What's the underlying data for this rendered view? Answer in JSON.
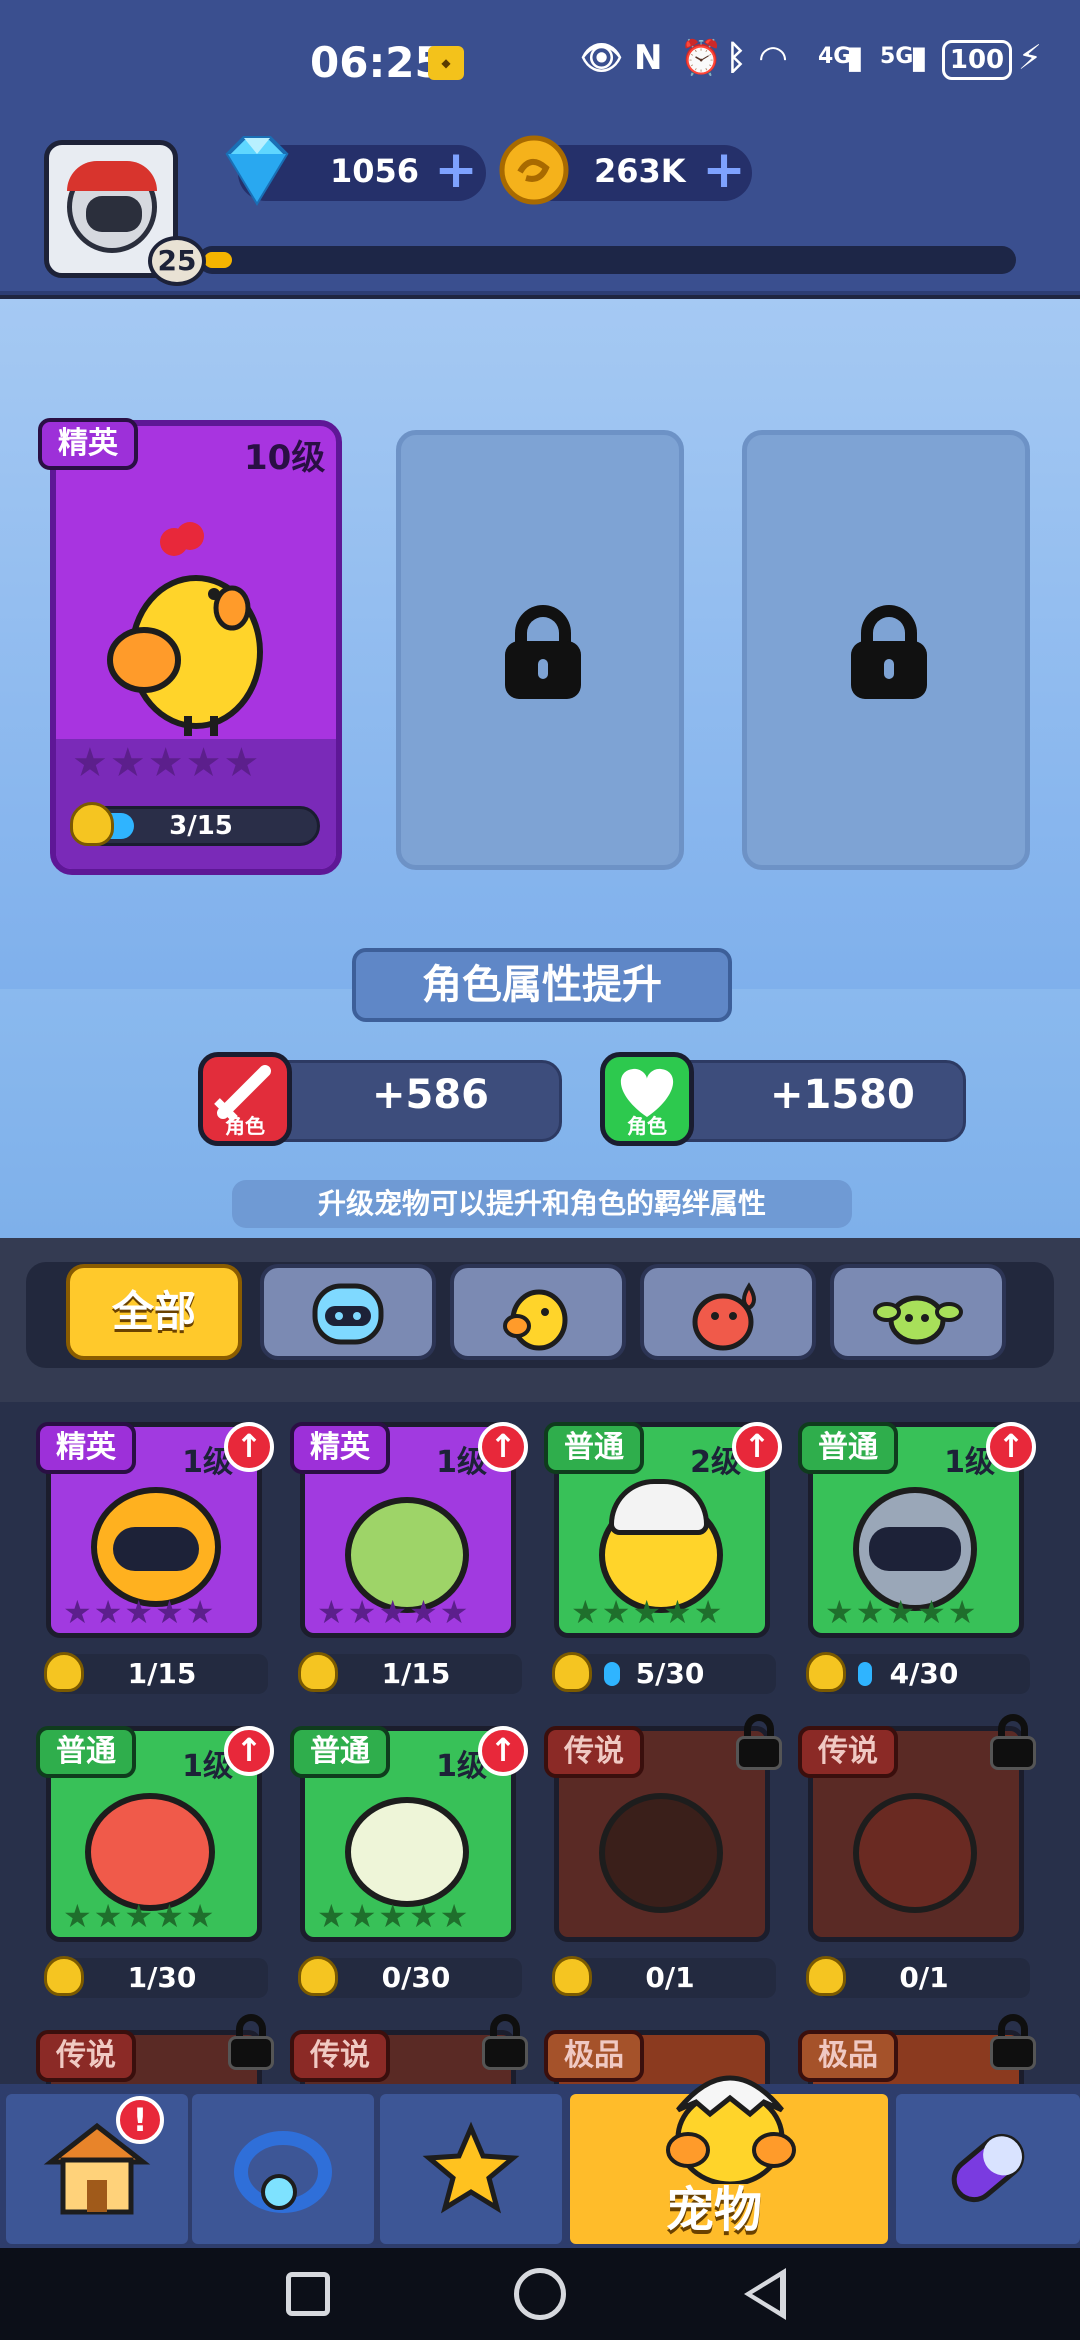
{
  "status_bar": {
    "time": "06:25",
    "battery": "100",
    "network1": "4G",
    "network2": "5G"
  },
  "player": {
    "level": "25",
    "gems": "1056",
    "coins": "263K",
    "xp_progress": 0.02
  },
  "equipped_slots": [
    {
      "rarity": "精英",
      "level": "10级",
      "progress": "3/15",
      "progress_value": 0.2,
      "stars": "★★★★★"
    },
    {
      "locked": true
    },
    {
      "locked": true
    }
  ],
  "bond": {
    "title": "角色属性提升",
    "attack_label": "角色",
    "attack_value": "+586",
    "hp_label": "角色",
    "hp_value": "+1580",
    "hint": "升级宠物可以提升和角色的羁绊属性"
  },
  "filter_tabs": {
    "all_label": "全部",
    "icons": [
      "robot-icon",
      "chick-icon",
      "fire-icon",
      "plant-icon"
    ]
  },
  "pets": [
    {
      "rarity": "精英",
      "level": "1级",
      "progress": "1/15",
      "stars": "★★★★★"
    },
    {
      "rarity": "精英",
      "level": "1级",
      "progress": "1/15",
      "stars": "★★★★★"
    },
    {
      "rarity": "普通",
      "level": "2级",
      "progress": "5/30",
      "stars": "★★★★★"
    },
    {
      "rarity": "普通",
      "level": "1级",
      "progress": "4/30",
      "stars": "★★★★★"
    },
    {
      "rarity": "普通",
      "level": "1级",
      "progress": "1/30",
      "stars": "★★★★★"
    },
    {
      "rarity": "普通",
      "level": "1级",
      "progress": "0/30",
      "stars": "★★★★★"
    },
    {
      "rarity": "传说",
      "progress": "0/1"
    },
    {
      "rarity": "传说",
      "progress": "0/1"
    },
    {
      "rarity": "传说"
    },
    {
      "rarity": "传说"
    },
    {
      "rarity": "极品"
    },
    {
      "rarity": "极品"
    }
  ],
  "bottom_nav": {
    "active_label": "宠物",
    "shop_badge": "!"
  }
}
